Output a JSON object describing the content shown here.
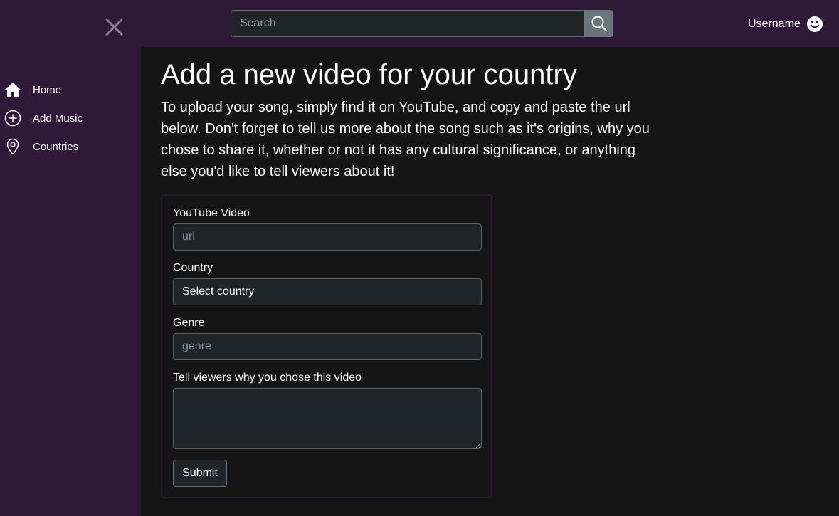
{
  "header": {
    "search_placeholder": "Search",
    "username": "Username",
    "icons": {
      "close": "close-icon",
      "search": "search-icon",
      "user": "smiley-icon"
    }
  },
  "sidebar": {
    "items": [
      {
        "label": "Home",
        "icon": "home-icon"
      },
      {
        "label": "Add Music",
        "icon": "plus-circle-icon"
      },
      {
        "label": "Countries",
        "icon": "location-pin-icon"
      }
    ]
  },
  "main": {
    "title": "Add a new video for your country",
    "intro": "To upload your song, simply find it on YouTube, and copy and paste the url below. Don't forget to tell us more about the song such as it's origins, why you chose to share it, whether or not it has any cultural significance, or anything else you'd like to tell viewers about it!"
  },
  "form": {
    "video_label": "YouTube Video",
    "video_placeholder": "url",
    "country_label": "Country",
    "country_selected": "Select country",
    "genre_label": "Genre",
    "genre_placeholder": "genre",
    "reason_label": "Tell viewers why you chose this video",
    "submit_label": "Submit"
  },
  "colors": {
    "chrome_purple": "#2e1938",
    "page_background": "#151515",
    "input_background": "#1e2428",
    "search_button": "#6c757d"
  }
}
